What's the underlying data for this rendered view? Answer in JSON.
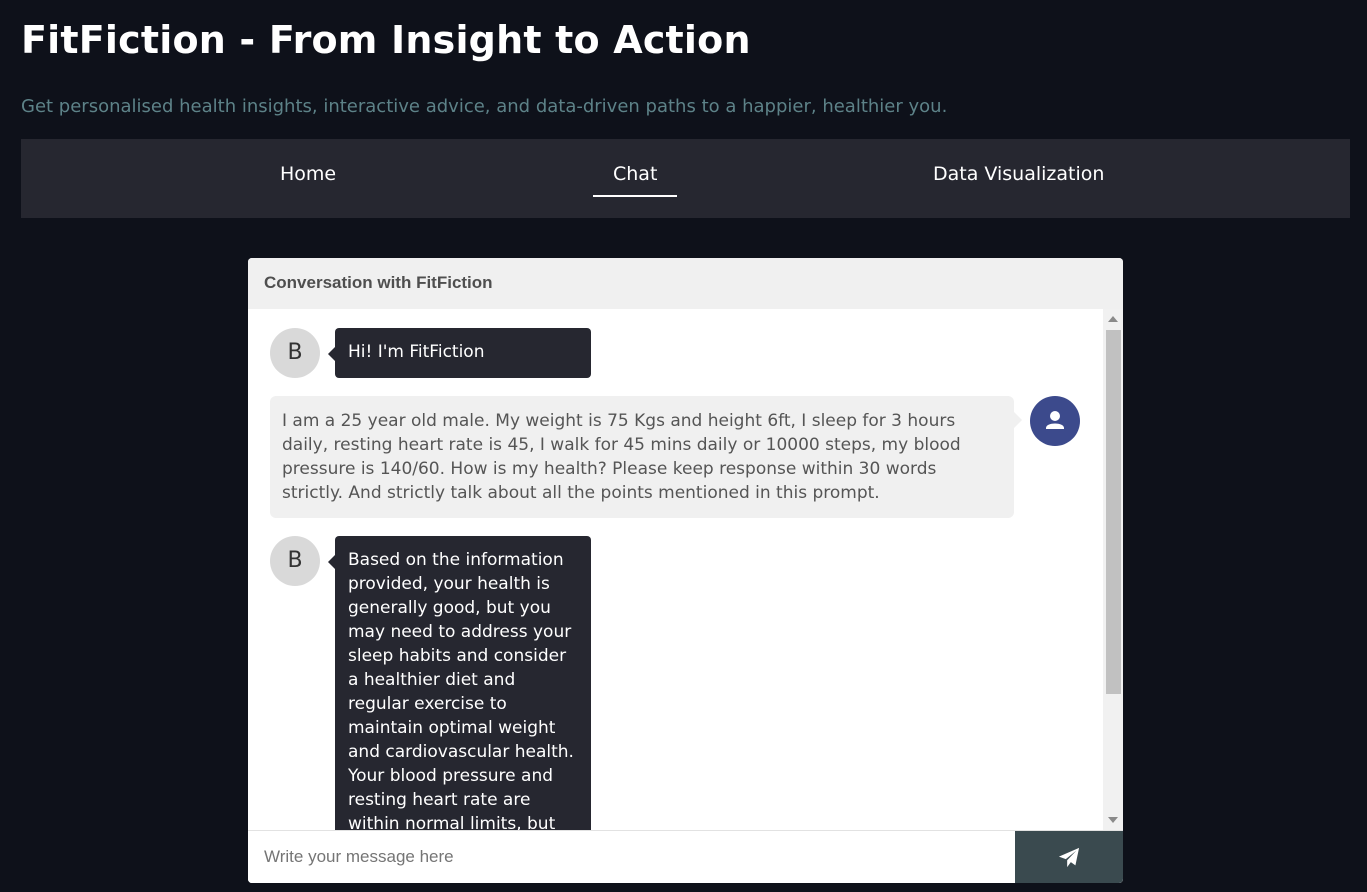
{
  "header": {
    "title": "FitFiction - From Insight to Action",
    "subtitle": "Get personalised health insights, interactive advice, and data-driven paths to a happier, healthier you."
  },
  "nav": {
    "tabs": [
      {
        "label": "Home",
        "active": false
      },
      {
        "label": "Chat",
        "active": true
      },
      {
        "label": "Data Visualization",
        "active": false
      }
    ]
  },
  "chat": {
    "title": "Conversation with FitFiction",
    "bot_initial": "B",
    "messages": [
      {
        "sender": "bot",
        "text": "Hi! I'm FitFiction"
      },
      {
        "sender": "user",
        "text": "I am a 25 year old male. My weight is 75 Kgs and height 6ft, I sleep for 3 hours daily, resting heart rate is 45, I walk for 45 mins daily or 10000 steps, my blood pressure is 140/60. How is my health? Please keep response within 30 words strictly. And strictly talk about all the points mentioned in this prompt."
      },
      {
        "sender": "bot",
        "text": "Based on the information provided, your health is generally good, but you may need to address your sleep habits and consider a healthier diet and regular exercise to maintain optimal weight and cardiovascular health. Your blood pressure and resting heart rate are within normal limits, but excessive sleep and low"
      }
    ],
    "input_placeholder": "Write your message here",
    "send_icon": "paper-plane-icon"
  },
  "colors": {
    "background": "#0e111a",
    "nav": "#262730",
    "bot_bubble": "#262730",
    "user_avatar": "#3c4a8c",
    "send_button": "#3a4a4f"
  }
}
